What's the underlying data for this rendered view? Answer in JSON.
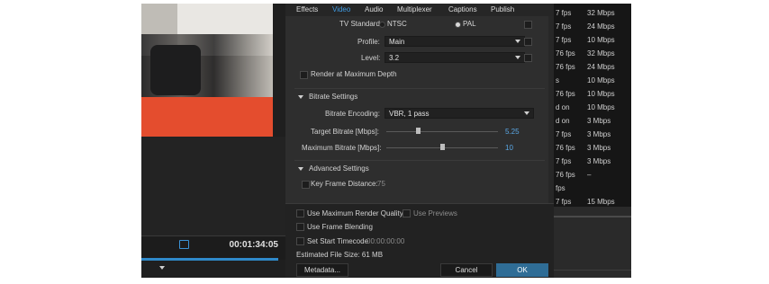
{
  "tabs": [
    "Effects",
    "Video",
    "Audio",
    "Multiplexer",
    "Captions",
    "Publish"
  ],
  "video": {
    "tv_standard_label": "TV Standard:",
    "ntsc": "NTSC",
    "pal": "PAL",
    "profile_label": "Profile:",
    "profile_value": "Main",
    "level_label": "Level:",
    "level_value": "3.2",
    "render_max_depth": "Render at Maximum Depth"
  },
  "bitrate": {
    "section": "Bitrate Settings",
    "encoding_label": "Bitrate Encoding:",
    "encoding_value": "VBR, 1 pass",
    "target_label": "Target Bitrate [Mbps]:",
    "target_value": "5.25",
    "target_fraction": 0.28,
    "max_label": "Maximum Bitrate [Mbps]:",
    "max_value": "10",
    "max_fraction": 0.5
  },
  "advanced": {
    "section": "Advanced Settings",
    "key_frame_label": "Key Frame Distance:",
    "key_frame_value": "75"
  },
  "bottom": {
    "max_render_quality": "Use Maximum Render Quality",
    "use_previews": "Use Previews",
    "frame_blending": "Use Frame Blending",
    "set_start_timecode": "Set Start Timecode",
    "start_timecode": "00:00:00:00",
    "estimated_size": "Estimated File Size: 61 MB",
    "metadata_btn": "Metadata...",
    "cancel_btn": "Cancel",
    "ok_btn": "OK"
  },
  "timeline": {
    "timecode": "00:01:34:05"
  },
  "table": [
    {
      "c1": "7 fps",
      "c2": "32 Mbps"
    },
    {
      "c1": "7 fps",
      "c2": "24 Mbps"
    },
    {
      "c1": "7 fps",
      "c2": "10 Mbps"
    },
    {
      "c1": "76 fps",
      "c2": "32 Mbps"
    },
    {
      "c1": "76 fps",
      "c2": "24 Mbps"
    },
    {
      "c1": "s",
      "c2": "10 Mbps"
    },
    {
      "c1": "76 fps",
      "c2": "10 Mbps"
    },
    {
      "c1": "d on",
      "c2": "10 Mbps"
    },
    {
      "c1": "d on",
      "c2": "3 Mbps"
    },
    {
      "c1": "7 fps",
      "c2": "3 Mbps"
    },
    {
      "c1": "76 fps",
      "c2": "3 Mbps"
    },
    {
      "c1": "7 fps",
      "c2": "3 Mbps"
    },
    {
      "c1": "76 fps",
      "c2": "–"
    },
    {
      "c1": "fps",
      "c2": ""
    },
    {
      "c1": "7 fps",
      "c2": "15 Mbps"
    }
  ]
}
